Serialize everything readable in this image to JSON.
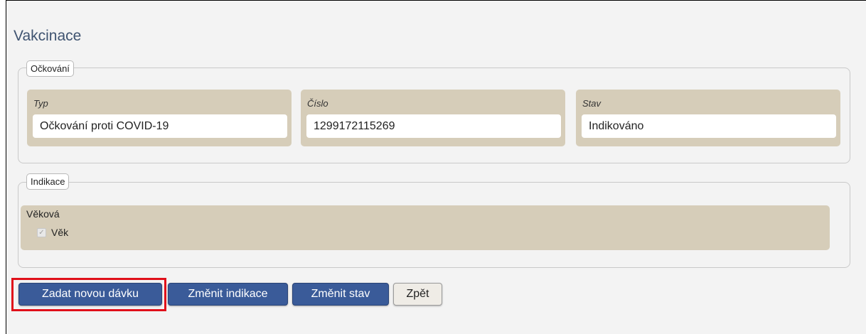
{
  "page": {
    "title": "Vakcinace"
  },
  "ockovani": {
    "legend": "Očkování",
    "fields": [
      {
        "label": "Typ",
        "value": "Očkování proti COVID-19"
      },
      {
        "label": "Číslo",
        "value": "1299172115269"
      },
      {
        "label": "Stav",
        "value": "Indikováno"
      }
    ]
  },
  "indikace": {
    "legend": "Indikace",
    "group_title": "Věková",
    "checkbox_label": "Věk",
    "checkbox_checked": true
  },
  "buttons": {
    "new_dose": "Zadat novou dávku",
    "change_indications": "Změnit indikace",
    "change_status": "Změnit stav",
    "back": "Zpět"
  },
  "colors": {
    "accent": "#3a5b99",
    "field_bg": "#d6cdb9",
    "highlight": "#e0101a"
  }
}
